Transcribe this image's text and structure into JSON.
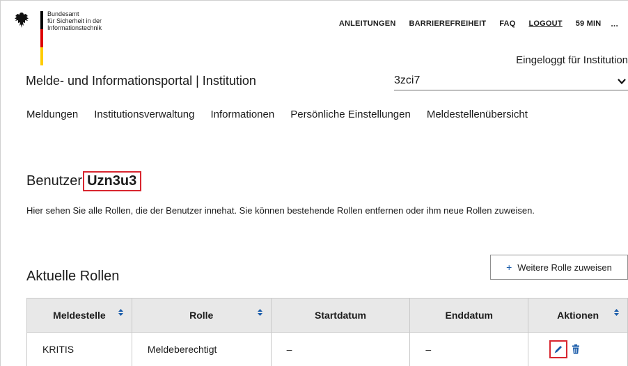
{
  "branding": {
    "logo_lines": [
      "Bundesamt",
      "für Sicherheit in der",
      "Informationstechnik"
    ],
    "flag_colors": [
      "#000000",
      "#dd0000",
      "#ffcc00"
    ]
  },
  "topnav": {
    "anleitungen": "ANLEITUNGEN",
    "barrierefreiheit": "BARRIEREFREIHEIT",
    "faq": "FAQ",
    "logout": "LOGOUT",
    "timer": "59 MIN",
    "more": "..."
  },
  "header": {
    "logged_in": "Eingeloggt für Institution",
    "portal_title": "Melde- und Informationsportal | Institution",
    "institution_select": "3zci7"
  },
  "mainnav": {
    "items": [
      "Meldungen",
      "Institutionsverwaltung",
      "Informationen",
      "Persönliche Einstellungen",
      "Meldestellenübersicht"
    ]
  },
  "user": {
    "heading_prefix": "Benutzer",
    "username": "Uzn3u3",
    "description": "Hier sehen Sie alle Rollen, die der Benutzer innehat. Sie können bestehende Rollen entfernen oder ihm neue Rollen zuweisen."
  },
  "roles": {
    "heading": "Aktuelle Rollen",
    "add_button": "Weitere Rolle zuweisen",
    "columns": [
      "Meldestelle",
      "Rolle",
      "Startdatum",
      "Enddatum",
      "Aktionen"
    ],
    "rows": [
      {
        "meldestelle": "KRITIS",
        "rolle": "Meldeberechtigt",
        "startdatum": "–",
        "enddatum": "–"
      }
    ]
  },
  "colors": {
    "accent_blue": "#1a5caa",
    "highlight_red": "#d8262f",
    "header_bg": "#e8e8e8"
  }
}
